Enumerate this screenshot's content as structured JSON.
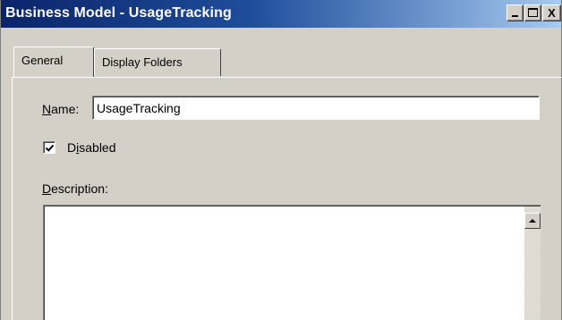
{
  "window": {
    "title": "Business Model - UsageTracking",
    "controls": {
      "minimize": "_",
      "maximize": "□",
      "close": "X"
    }
  },
  "tabs": [
    {
      "label": "General",
      "selected": true
    },
    {
      "label": "Display Folders",
      "selected": false
    }
  ],
  "form": {
    "name_label_mnemonic": "N",
    "name_label_rest": "ame:",
    "name_value": "UsageTracking",
    "disabled_label_pre": "D",
    "disabled_label_mnemonic": "i",
    "disabled_label_rest": "sabled",
    "disabled_checked": true,
    "description_label_mnemonic": "D",
    "description_label_rest": "escription:",
    "description_value": ""
  }
}
